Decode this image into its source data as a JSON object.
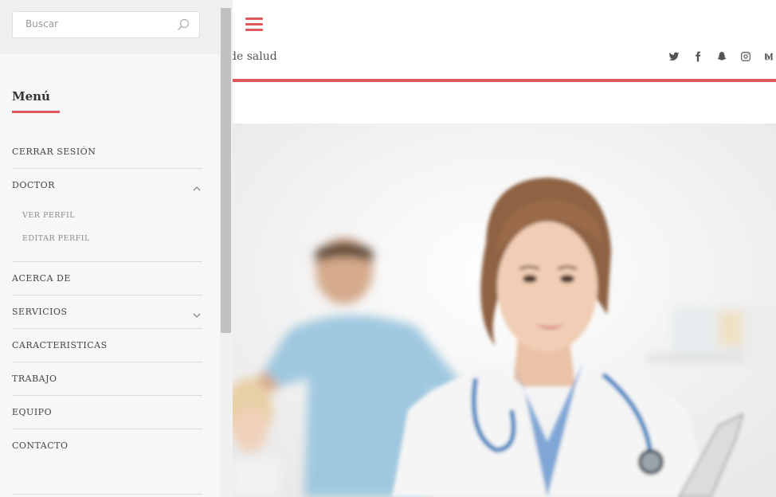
{
  "header": {
    "tagline": "de salud",
    "menu_toggle_icon": "hamburger-icon",
    "social_icons": [
      "twitter-icon",
      "facebook-icon",
      "snapchat-icon",
      "instagram-icon",
      "medium-icon"
    ],
    "accent_color": "#e0595b"
  },
  "sidebar": {
    "search": {
      "placeholder": "Buscar",
      "value": "",
      "icon": "search-icon"
    },
    "menu_title": "Menú",
    "items": [
      {
        "label": "CERRAR SESIÓN"
      },
      {
        "label": "DOCTOR",
        "expanded": true,
        "chevron": "chevron-up-icon",
        "subitems": [
          {
            "label": "VER PERFIL"
          },
          {
            "label": "EDITAR PERFIL"
          }
        ]
      },
      {
        "label": "ACERCA DE"
      },
      {
        "label": "SERVICIOS",
        "expanded": false,
        "chevron": "chevron-down-icon"
      },
      {
        "label": "CARACTERISTICAS"
      },
      {
        "label": "TRABAJO"
      },
      {
        "label": "EQUIPO"
      },
      {
        "label": "CONTACTO"
      }
    ]
  },
  "hero": {
    "image": "doctor-photo"
  }
}
